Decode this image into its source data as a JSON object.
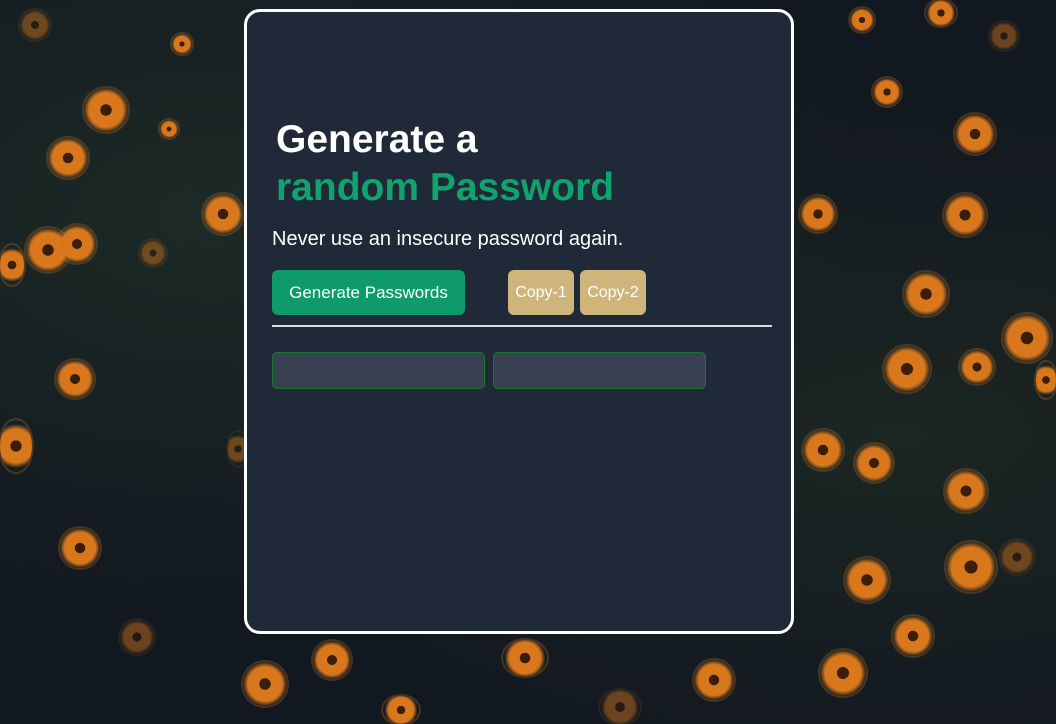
{
  "hero": {
    "title_line1": "Generate a",
    "title_line2": "random Password",
    "subtitle": "Never use an insecure password again."
  },
  "actions": {
    "generate_label": "Generate Passwords",
    "copy1_label": "Copy-1",
    "copy2_label": "Copy-2"
  },
  "passwords": {
    "field1_value": "",
    "field2_value": ""
  },
  "colors": {
    "card_bg": "#1f2937",
    "accent_green": "#10a36e",
    "copy_button": "#cfb57b",
    "field_bg": "#374151",
    "field_border": "#167a2c"
  }
}
